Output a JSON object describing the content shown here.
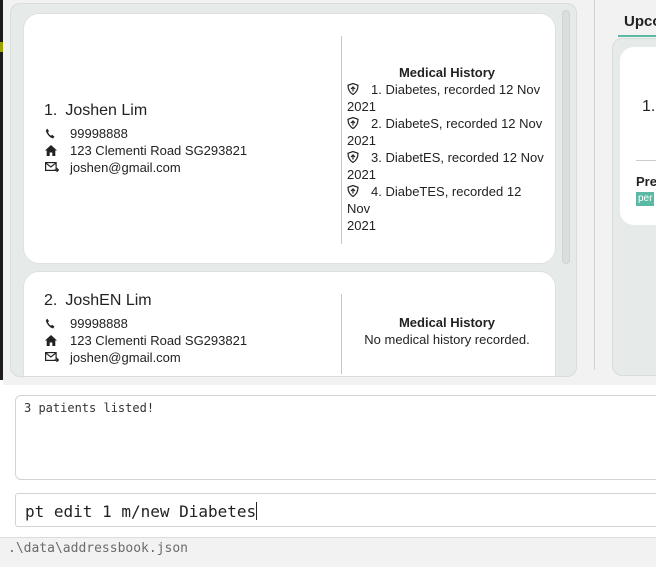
{
  "patients": [
    {
      "index": "1.",
      "name": "Joshen Lim",
      "phone": "99998888",
      "address": "123 Clementi Road SG293821",
      "email": "joshen@gmail.com",
      "medical_history_title": "Medical History",
      "medical_history": [
        "1. Diabetes, recorded 12 Nov",
        "2. DiabeteS, recorded 12 Nov",
        "3. DiabetES, recorded 12 Nov",
        "4. DiabeTES, recorded 12 Nov"
      ],
      "medical_history_year": "2021"
    },
    {
      "index": "2.",
      "name": "JoshEN Lim",
      "phone": "99998888",
      "address": "123 Clementi Road SG293821",
      "email": "joshen@gmail.com",
      "medical_history_title": "Medical History",
      "medical_history_empty": "No medical history recorded."
    }
  ],
  "upcoming_panel": {
    "title": "Upco",
    "card_number": "1.",
    "section_label": "Pre",
    "badge": "per"
  },
  "result_display": {
    "text": "3 patients listed!"
  },
  "command_box": {
    "value": "pt edit 1 m/new Diabetes"
  },
  "status_bar": {
    "path": ".\\data\\addressbook.json"
  },
  "colors": {
    "accent": "#5ab8a4",
    "card_background": "#ffffff",
    "panel_background": "#e6eae8"
  }
}
